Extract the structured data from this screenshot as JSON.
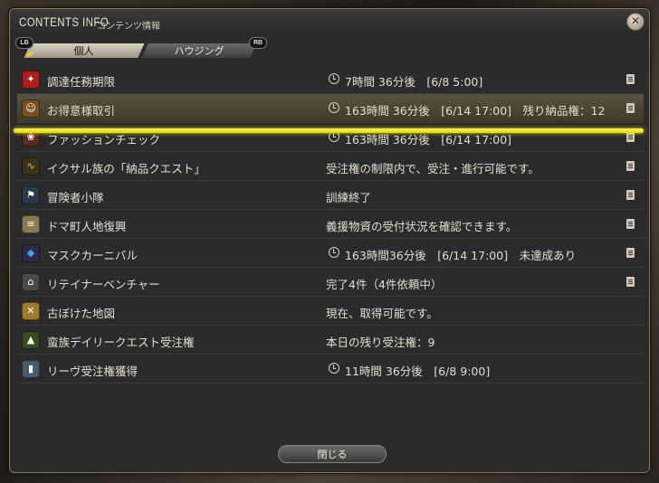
{
  "window": {
    "title_en": "CONTENTS INFO",
    "title_jp": "コンテンツ情報",
    "close_glyph": "✕"
  },
  "tabs": {
    "lb": "LB",
    "rb": "RB",
    "items": [
      {
        "label": "個人"
      },
      {
        "label": "ハウジング"
      }
    ]
  },
  "rows": [
    {
      "name": "調達任務期限",
      "status": "7時間 36分後　[6/8 5:00]",
      "icon": "seal-icon"
    },
    {
      "name": "お得意様取引",
      "status": "163時間 36分後　[6/14 17:00]　残り納品権：12",
      "icon": "customer-icon"
    },
    {
      "name": "ファッションチェック",
      "status": "163時間 36分後　[6/14 17:00]",
      "icon": "rose-icon"
    },
    {
      "name": "イクサル族の「納品クエスト」",
      "status": "受注権の制限内で、受注・進行可能です。",
      "icon": "ixal-icon"
    },
    {
      "name": "冒険者小隊",
      "status": "訓練終了",
      "icon": "squadron-flag-icon"
    },
    {
      "name": "ドマ町人地復興",
      "status": "義援物資の受付状況を確認できます。",
      "icon": "scroll-icon"
    },
    {
      "name": "マスクカーニバル",
      "status": "163時間36分後　[6/14 17:00]　未達成あり",
      "icon": "mask-icon"
    },
    {
      "name": "リテイナーベンチャー",
      "status": "完了4件（4件依頼中）",
      "icon": "building-icon"
    },
    {
      "name": "古ぼけた地図",
      "status": "現在、取得可能です。",
      "icon": "treasure-map-icon"
    },
    {
      "name": "蛮族デイリークエスト受注権",
      "status": "本日の残り受注権：9",
      "icon": "tent-icon"
    },
    {
      "name": "リーヴ受注権獲得",
      "status": "11時間 36分後　[6/8 9:00]",
      "icon": "leve-card-icon"
    }
  ],
  "footer": {
    "close_label": "閉じる"
  }
}
